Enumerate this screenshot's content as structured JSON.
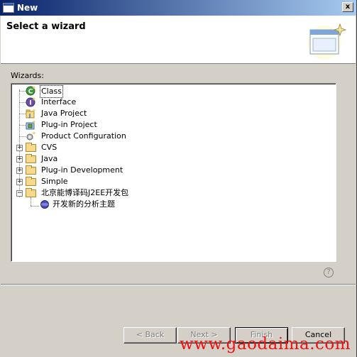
{
  "window": {
    "title": "New",
    "close_glyph": "x"
  },
  "header": {
    "title": "Select a wizard"
  },
  "wizards_label": "Wizards:",
  "tree": [
    {
      "label": "Class",
      "icon": "class-icon"
    },
    {
      "label": "Interface",
      "icon": "interface-icon"
    },
    {
      "label": "Java Project",
      "icon": "java-project-icon"
    },
    {
      "label": "Plug-in Project",
      "icon": "plugin-project-icon"
    },
    {
      "label": "Product Configuration",
      "icon": "product-config-icon"
    },
    {
      "label": "CVS",
      "icon": "folder-icon"
    },
    {
      "label": "Java",
      "icon": "folder-icon"
    },
    {
      "label": "Plug-in Development",
      "icon": "folder-icon"
    },
    {
      "label": "Simple",
      "icon": "folder-icon"
    },
    {
      "label": "北京能博译码J2EE开发包",
      "icon": "folder-icon"
    },
    {
      "label": "开发新的分析主题",
      "icon": "topic-icon"
    }
  ],
  "help_glyph": "?",
  "buttons": {
    "back": "< Back",
    "next": "Next >",
    "finish": "Finish",
    "cancel": "Cancel"
  },
  "watermark": "www.gaodaima.com"
}
